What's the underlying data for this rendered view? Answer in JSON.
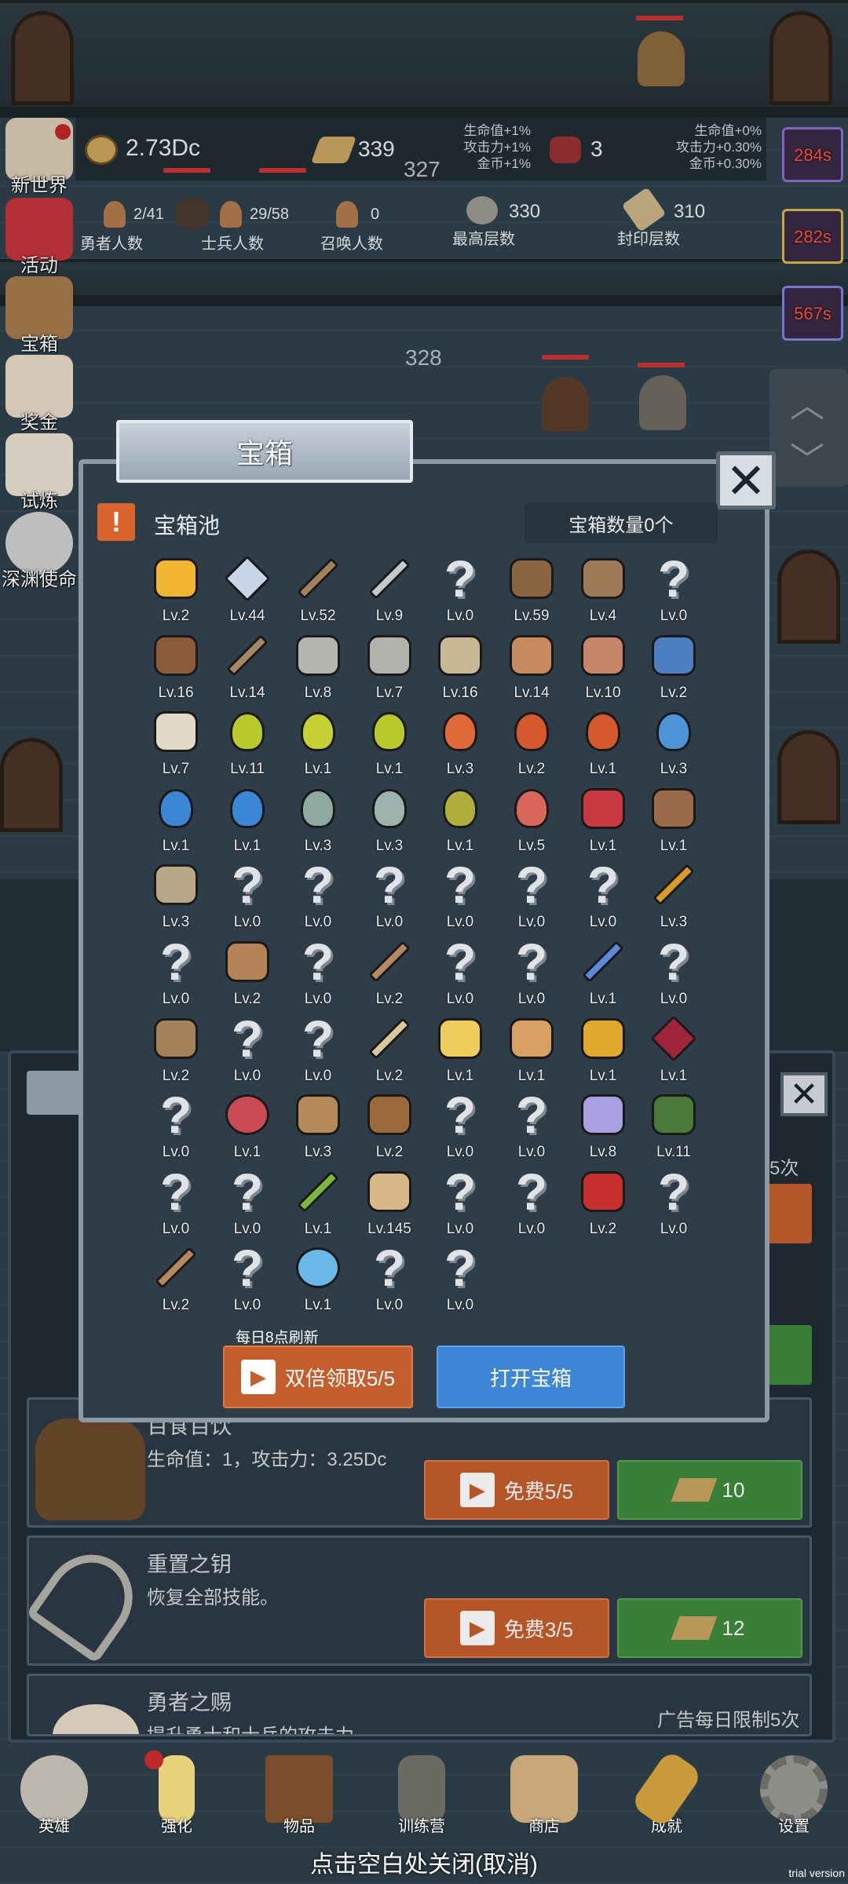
{
  "hud": {
    "gold": "2.73Dc",
    "bars": "339",
    "gems": "3",
    "bonus_left": [
      "生命值+1%",
      "攻击力+1%",
      "金币+1%"
    ],
    "bonus_right": [
      "生命值+0%",
      "攻击力+0.30%",
      "金币+0.30%"
    ],
    "floor_top": "327",
    "floor_mid": "328",
    "heroes_value": "2/41",
    "heroes_label": "勇者人数",
    "soldiers_value": "29/58",
    "soldiers_label": "士兵人数",
    "summons_value": "0",
    "summons_label": "召唤人数",
    "max_floor_value": "330",
    "max_floor_label": "最高层数",
    "seal_floor_value": "310",
    "seal_floor_label": "封印层数"
  },
  "sidebar": {
    "items": [
      {
        "label": "新世界",
        "color": "#d8cbb4"
      },
      {
        "label": "活动",
        "color": "#c2333b"
      },
      {
        "label": "宝箱",
        "color": "#a57a4d"
      },
      {
        "label": "奖金",
        "color": "#e8d8c8"
      },
      {
        "label": "试炼",
        "color": "#e8e0d0"
      },
      {
        "label": "深渊使命",
        "color": "#cfcfcf"
      }
    ]
  },
  "timers": [
    "284s",
    "282s",
    "567s"
  ],
  "modal": {
    "tab_title": "宝箱",
    "pool_label": "宝箱池",
    "chest_count": "宝箱数量0个",
    "refresh_note": "每日8点刷新",
    "double_button": "双倍领取5/5",
    "open_button": "打开宝箱",
    "items": [
      {
        "kind": "crown",
        "color": "#f2b531",
        "lv": "Lv.2"
      },
      {
        "kind": "diamond",
        "color": "#c6d6e8",
        "lv": "Lv.44"
      },
      {
        "kind": "sword",
        "color": "#a1805a",
        "lv": "Lv.52"
      },
      {
        "kind": "sword",
        "color": "#c5c9cc",
        "lv": "Lv.9"
      },
      {
        "kind": "unknown",
        "lv": "Lv.0"
      },
      {
        "kind": "armor",
        "color": "#8a6340",
        "lv": "Lv.59"
      },
      {
        "kind": "armor",
        "color": "#9c7a58",
        "lv": "Lv.4"
      },
      {
        "kind": "unknown",
        "lv": "Lv.0"
      },
      {
        "kind": "helm",
        "color": "#8a5a3a",
        "lv": "Lv.16"
      },
      {
        "kind": "dagger",
        "color": "#a78864",
        "lv": "Lv.14"
      },
      {
        "kind": "helm",
        "color": "#b6b6b0",
        "lv": "Lv.8"
      },
      {
        "kind": "hammer",
        "color": "#b1b1ad",
        "lv": "Lv.7"
      },
      {
        "kind": "helm",
        "color": "#c9b896",
        "lv": "Lv.16"
      },
      {
        "kind": "meat",
        "color": "#c88a5e",
        "lv": "Lv.14"
      },
      {
        "kind": "meat",
        "color": "#c7856a",
        "lv": "Lv.10"
      },
      {
        "kind": "bag",
        "color": "#4c7ec4",
        "lv": "Lv.2"
      },
      {
        "kind": "bread",
        "color": "#e2d8c6",
        "lv": "Lv.7"
      },
      {
        "kind": "potion",
        "color": "#b9c92a",
        "lv": "Lv.11"
      },
      {
        "kind": "potion",
        "color": "#c8d133",
        "lv": "Lv.1"
      },
      {
        "kind": "potion",
        "color": "#b9c92a",
        "lv": "Lv.1"
      },
      {
        "kind": "potion",
        "color": "#e06a3a",
        "lv": "Lv.3"
      },
      {
        "kind": "potion",
        "color": "#d6582e",
        "lv": "Lv.2"
      },
      {
        "kind": "potion",
        "color": "#d6582e",
        "lv": "Lv.1"
      },
      {
        "kind": "potion",
        "color": "#4d95d8",
        "lv": "Lv.3"
      },
      {
        "kind": "potion",
        "color": "#3c86d6",
        "lv": "Lv.1"
      },
      {
        "kind": "potion",
        "color": "#3c86d6",
        "lv": "Lv.1"
      },
      {
        "kind": "potion",
        "color": "#8fa8a2",
        "lv": "Lv.3"
      },
      {
        "kind": "potion",
        "color": "#9fb3ae",
        "lv": "Lv.3"
      },
      {
        "kind": "bottle",
        "color": "#b0ae3c",
        "lv": "Lv.1"
      },
      {
        "kind": "bottle",
        "color": "#d8665a",
        "lv": "Lv.5"
      },
      {
        "kind": "boot",
        "color": "#c83840",
        "lv": "Lv.1"
      },
      {
        "kind": "boot",
        "color": "#9a6a4a",
        "lv": "Lv.1"
      },
      {
        "kind": "boot",
        "color": "#b8a888",
        "lv": "Lv.3"
      },
      {
        "kind": "unknown",
        "lv": "Lv.0"
      },
      {
        "kind": "unknown",
        "lv": "Lv.0"
      },
      {
        "kind": "unknown",
        "lv": "Lv.0"
      },
      {
        "kind": "unknown",
        "lv": "Lv.0"
      },
      {
        "kind": "unknown",
        "lv": "Lv.0"
      },
      {
        "kind": "unknown",
        "lv": "Lv.0"
      },
      {
        "kind": "torch",
        "color": "#d89a2a",
        "lv": "Lv.3"
      },
      {
        "kind": "unknown",
        "lv": "Lv.0"
      },
      {
        "kind": "mushroom",
        "color": "#b48458",
        "lv": "Lv.2"
      },
      {
        "kind": "unknown",
        "lv": "Lv.0"
      },
      {
        "kind": "staff",
        "color": "#b48a62",
        "lv": "Lv.2"
      },
      {
        "kind": "unknown",
        "lv": "Lv.0"
      },
      {
        "kind": "unknown",
        "lv": "Lv.0"
      },
      {
        "kind": "staff",
        "color": "#5a8ad8",
        "lv": "Lv.1"
      },
      {
        "kind": "unknown",
        "lv": "Lv.0"
      },
      {
        "kind": "armor",
        "color": "#a5825a",
        "lv": "Lv.2"
      },
      {
        "kind": "unknown",
        "lv": "Lv.0"
      },
      {
        "kind": "unknown",
        "lv": "Lv.0"
      },
      {
        "kind": "torch",
        "color": "#d8c89a",
        "lv": "Lv.2"
      },
      {
        "kind": "cheese",
        "color": "#f0cc5a",
        "lv": "Lv.1"
      },
      {
        "kind": "bread",
        "color": "#d8a062",
        "lv": "Lv.1"
      },
      {
        "kind": "jar",
        "color": "#e0a82c",
        "lv": "Lv.1"
      },
      {
        "kind": "gem",
        "color": "#a0243a",
        "lv": "Lv.1"
      },
      {
        "kind": "unknown",
        "lv": "Lv.0"
      },
      {
        "kind": "orb",
        "color": "#c94a52",
        "lv": "Lv.1"
      },
      {
        "kind": "bow",
        "color": "#b48a5a",
        "lv": "Lv.3"
      },
      {
        "kind": "quiver",
        "color": "#9a6a3a",
        "lv": "Lv.2"
      },
      {
        "kind": "unknown",
        "lv": "Lv.0"
      },
      {
        "kind": "unknown",
        "lv": "Lv.0"
      },
      {
        "kind": "ring",
        "color": "#a8a0e0",
        "lv": "Lv.8"
      },
      {
        "kind": "shield",
        "color": "#4a7a3a",
        "lv": "Lv.11"
      },
      {
        "kind": "unknown",
        "lv": "Lv.0"
      },
      {
        "kind": "unknown",
        "lv": "Lv.0"
      },
      {
        "kind": "staff",
        "color": "#7cb83c",
        "lv": "Lv.1"
      },
      {
        "kind": "mug",
        "color": "#d8b886",
        "lv": "Lv.145"
      },
      {
        "kind": "unknown",
        "lv": "Lv.0"
      },
      {
        "kind": "unknown",
        "lv": "Lv.0"
      },
      {
        "kind": "book",
        "color": "#c8302e",
        "lv": "Lv.2"
      },
      {
        "kind": "unknown",
        "lv": "Lv.0"
      },
      {
        "kind": "whip",
        "color": "#b4885a",
        "lv": "Lv.2"
      },
      {
        "kind": "unknown",
        "lv": "Lv.0"
      },
      {
        "kind": "orb",
        "color": "#6ab8e8",
        "lv": "Lv.1"
      },
      {
        "kind": "unknown",
        "lv": "Lv.0"
      },
      {
        "kind": "unknown",
        "lv": "Lv.0"
      }
    ]
  },
  "back_panel": {
    "partial_limit": "5次",
    "row1": {
      "title": "百食百饮",
      "desc": "生命值：1，攻击力：3.25Dc",
      "free_button": "免费5/5",
      "cost": "10"
    },
    "row2": {
      "title": "重置之钥",
      "desc": "恢复全部技能。",
      "free_button": "免费3/5",
      "cost": "12"
    },
    "row3": {
      "title": "勇者之赐",
      "desc": "提升勇士和士兵的攻击力。",
      "limit": "广告每日限制5次"
    }
  },
  "nav": {
    "items": [
      {
        "label": "英雄",
        "color": "#bdb8ad"
      },
      {
        "label": "强化",
        "color": "#e8d27a"
      },
      {
        "label": "物品",
        "color": "#7a4e2c"
      },
      {
        "label": "训练营",
        "color": "#6a6a62"
      },
      {
        "label": "商店",
        "color": "#c8a878"
      },
      {
        "label": "成就",
        "color": "#c99a3a"
      },
      {
        "label": "设置",
        "color": "#8d8d8a"
      }
    ]
  },
  "close_hint": "点击空白处关闭(取消)",
  "watermark": "trial version"
}
